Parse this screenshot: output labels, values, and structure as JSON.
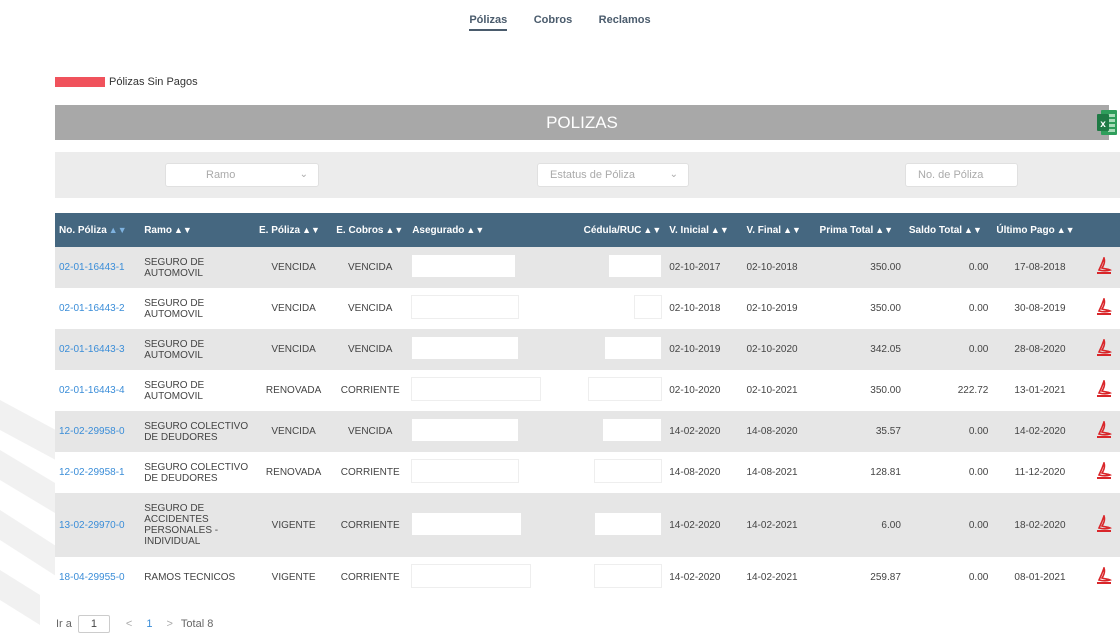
{
  "nav": {
    "items": [
      "Pólizas",
      "Cobros",
      "Reclamos"
    ],
    "active_index": 0
  },
  "legend": {
    "label": "Pólizas Sin Pagos",
    "color": "#f0525c"
  },
  "title": "POLIZAS",
  "filters": {
    "ramo_placeholder": "Ramo",
    "estatus_placeholder": "Estatus de Póliza",
    "poliza_placeholder": "No. de Póliza"
  },
  "table": {
    "headers": [
      "No. Póliza",
      "Ramo",
      "E. Póliza",
      "E. Cobros",
      "Asegurado",
      "Cédula/RUC",
      "V. Inicial",
      "V. Final",
      "Prima Total",
      "Saldo Total",
      "Último Pago"
    ],
    "rows": [
      {
        "poliza": "02-01-16443-1",
        "ramo": "SEGURO DE AUTOMOVIL",
        "e_poliza": "VENCIDA",
        "e_cobros": "VENCIDA",
        "v_inicial": "02-10-2017",
        "v_final": "02-10-2018",
        "prima": "350.00",
        "saldo": "0.00",
        "ultimo": "17-08-2018"
      },
      {
        "poliza": "02-01-16443-2",
        "ramo": "SEGURO DE AUTOMOVIL",
        "e_poliza": "VENCIDA",
        "e_cobros": "VENCIDA",
        "v_inicial": "02-10-2018",
        "v_final": "02-10-2019",
        "prima": "350.00",
        "saldo": "0.00",
        "ultimo": "30-08-2019"
      },
      {
        "poliza": "02-01-16443-3",
        "ramo": "SEGURO DE AUTOMOVIL",
        "e_poliza": "VENCIDA",
        "e_cobros": "VENCIDA",
        "v_inicial": "02-10-2019",
        "v_final": "02-10-2020",
        "prima": "342.05",
        "saldo": "0.00",
        "ultimo": "28-08-2020"
      },
      {
        "poliza": "02-01-16443-4",
        "ramo": "SEGURO DE AUTOMOVIL",
        "e_poliza": "RENOVADA",
        "e_cobros": "CORRIENTE",
        "v_inicial": "02-10-2020",
        "v_final": "02-10-2021",
        "prima": "350.00",
        "saldo": "222.72",
        "ultimo": "13-01-2021"
      },
      {
        "poliza": "12-02-29958-0",
        "ramo": "SEGURO COLECTIVO DE DEUDORES",
        "e_poliza": "VENCIDA",
        "e_cobros": "VENCIDA",
        "v_inicial": "14-02-2020",
        "v_final": "14-08-2020",
        "prima": "35.57",
        "saldo": "0.00",
        "ultimo": "14-02-2020"
      },
      {
        "poliza": "12-02-29958-1",
        "ramo": "SEGURO COLECTIVO DE DEUDORES",
        "e_poliza": "RENOVADA",
        "e_cobros": "CORRIENTE",
        "v_inicial": "14-08-2020",
        "v_final": "14-08-2021",
        "prima": "128.81",
        "saldo": "0.00",
        "ultimo": "11-12-2020"
      },
      {
        "poliza": "13-02-29970-0",
        "ramo": "SEGURO DE ACCIDENTES PERSONALES - INDIVIDUAL",
        "e_poliza": "VIGENTE",
        "e_cobros": "CORRIENTE",
        "v_inicial": "14-02-2020",
        "v_final": "14-02-2021",
        "prima": "6.00",
        "saldo": "0.00",
        "ultimo": "18-02-2020"
      },
      {
        "poliza": "18-04-29955-0",
        "ramo": "RAMOS TECNICOS",
        "e_poliza": "VIGENTE",
        "e_cobros": "CORRIENTE",
        "v_inicial": "14-02-2020",
        "v_final": "14-02-2021",
        "prima": "259.87",
        "saldo": "0.00",
        "ultimo": "08-01-2021"
      }
    ]
  },
  "pager": {
    "goto_label": "Ir a",
    "goto_value": "1",
    "current_page": "1",
    "total_label": "Total 8"
  },
  "icons": {
    "excel": "excel-export-icon",
    "pdf": "pdf-file-icon",
    "sort": "sort-arrows-icon"
  },
  "colors": {
    "header_bg": "#456780",
    "link": "#3a8dd8",
    "title_bar": "#a8a8a8",
    "excel_green": "#1f7a45"
  }
}
